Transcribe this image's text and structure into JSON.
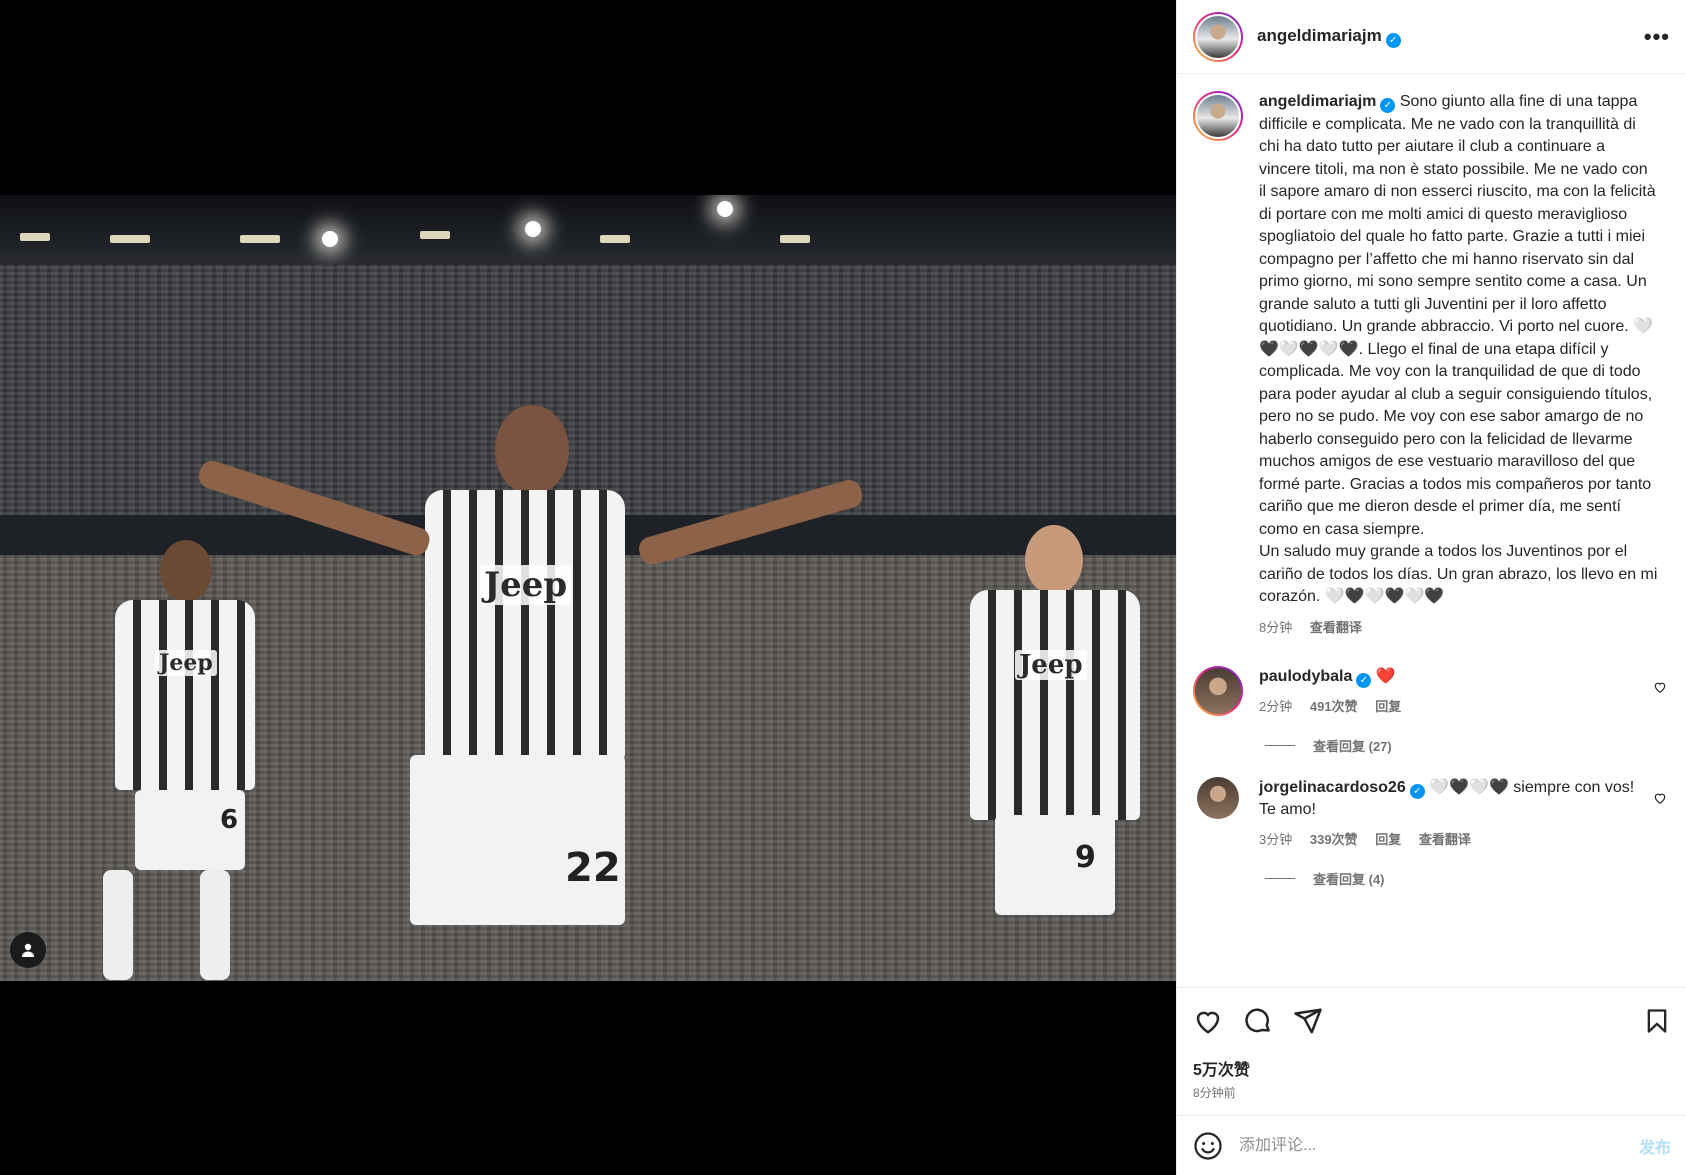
{
  "post": {
    "author": "angeldimariajm",
    "verified": true
  },
  "caption": {
    "username": "angeldimariajm",
    "text": "Sono giunto alla fine di una tappa difficile e complicata. Me ne vado con la tranquillità di chi ha dato tutto per aiutare il club a continuare a vincere titoli, ma non è stato possibile. Me ne vado con il sapore amaro di non esserci riuscito, ma con la felicità di portare con me molti amici di questo meraviglioso spogliatoio del quale ho fatto parte. Grazie a tutti i miei compagno per l’affetto che mi hanno riservato sin dal primo giorno, mi sono sempre sentito come a casa. Un grande saluto a tutti gli Juventini per il loro affetto quotidiano. Un grande abbraccio. Vi porto nel cuore. 🤍🖤🤍🖤🤍🖤. Llego el final de una etapa difícil y complicada. Me voy con la tranquilidad de que di todo para poder ayudar al club a seguir consiguiendo títulos, pero no se pudo. Me voy con ese sabor amargo de no haberlo conseguido pero con la felicidad de llevarme muchos amigos de ese vestuario maravilloso del que formé parte. Gracias a todos mis compañeros por tanto cariño que me dieron desde el primer día, me sentí como en casa siempre.\nUn saludo muy grande a todos los Juventinos por el cariño de todos los días. Un gran abrazo, los llevo en mi corazón. 🤍🖤🤍🖤🤍🖤",
    "time": "8分钟",
    "translate": "查看翻译"
  },
  "comments": [
    {
      "username": "paulodybala",
      "text": "❤️",
      "time": "2分钟",
      "likes": "491次赞",
      "reply": "回复",
      "view_replies": "查看回复 (27)"
    },
    {
      "username": "jorgelinacardoso26",
      "text": "🤍🖤🤍🖤 siempre con vos! Te amo!",
      "time": "3分钟",
      "likes": "339次赞",
      "reply": "回复",
      "translate": "查看翻译",
      "view_replies": "查看回复 (4)"
    }
  ],
  "stats": {
    "likes": "5万次赞",
    "posted": "8分钟前"
  },
  "comment_box": {
    "placeholder": "添加评论...",
    "post_label": "发布"
  },
  "photo": {
    "sponsor_text": "Jeep",
    "jersey_numbers": [
      "6",
      "22",
      "9"
    ]
  },
  "colors": {
    "verified": "#0095f6",
    "post_button_disabled": "#b2dffc"
  },
  "icons": {
    "user_tag": "person-icon",
    "more": "more-icon",
    "like": "heart-icon",
    "comment": "comment-icon",
    "share": "send-icon",
    "save": "bookmark-icon",
    "emoji": "emoji-icon"
  }
}
